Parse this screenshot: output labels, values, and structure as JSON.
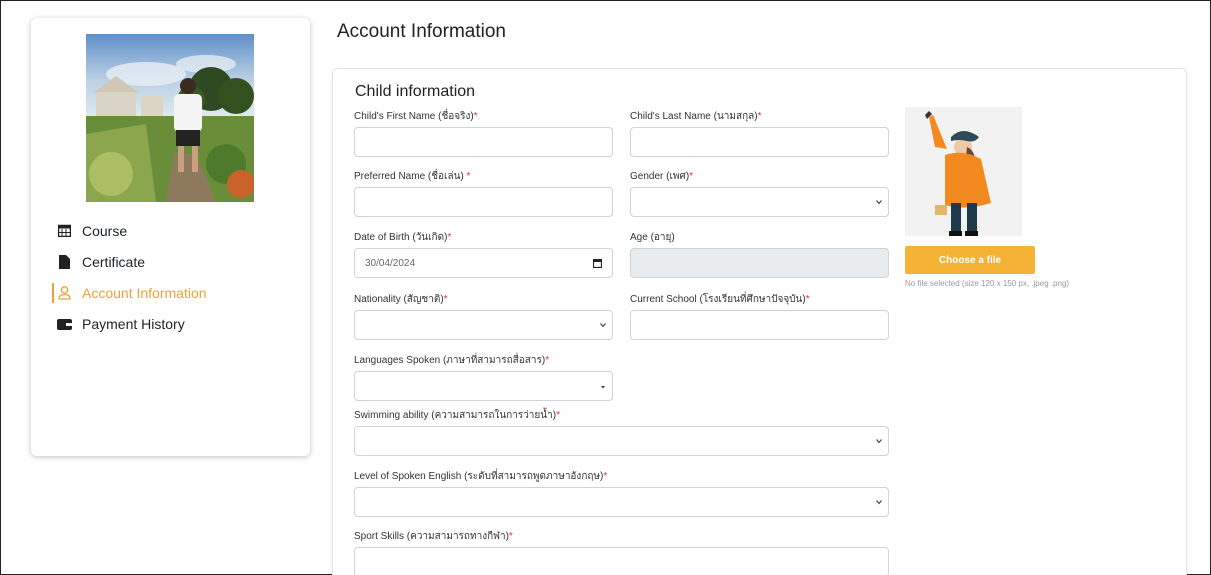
{
  "page_title": "Account Information",
  "sidebar": {
    "items": [
      {
        "label": "Course",
        "icon": "calendar-icon"
      },
      {
        "label": "Certificate",
        "icon": "file-icon"
      },
      {
        "label": "Account Information",
        "icon": "user-icon",
        "active": true
      },
      {
        "label": "Payment History",
        "icon": "wallet-icon"
      }
    ]
  },
  "form": {
    "section_title": "Child information",
    "first_name": {
      "label": "Child's First Name (ชื่อจริง)",
      "value": ""
    },
    "last_name": {
      "label": "Child's Last Name (นามสกุล)",
      "value": ""
    },
    "preferred_name": {
      "label": "Preferred Name (ชื่อเล่น) ",
      "value": ""
    },
    "gender": {
      "label": "Gender (เพศ)",
      "value": ""
    },
    "dob": {
      "label": "Date of Birth (วันเกิด)",
      "value": "30/04/2024"
    },
    "age": {
      "label": "Age (อายุ)",
      "value": ""
    },
    "nationality": {
      "label": "Nationality (สัญชาติ)",
      "value": ""
    },
    "current_school": {
      "label": "Current School (โรงเรียนที่ศึกษาปัจจุบัน)",
      "value": ""
    },
    "languages": {
      "label": "Languages Spoken (ภาษาที่สามารถสื่อสาร)",
      "value": ""
    },
    "swimming": {
      "label": "Swimming ability (ความสามารถในการว่ายน้ำ)",
      "value": ""
    },
    "english_level": {
      "label": "Level of Spoken English (ระดับที่สามารถพูดภาษาอังกฤษ)",
      "value": ""
    },
    "sport_skills": {
      "label": "Sport Skills (ความสามารถทางกีฬา)",
      "value": ""
    },
    "required_mark": "*"
  },
  "upload": {
    "button_label": "Choose a file",
    "note": "No file selected (size 120 x 150 px, .jpeg .png)"
  },
  "colors": {
    "accent": "#f0a236",
    "button": "#f5b335",
    "required": "#e03131"
  }
}
